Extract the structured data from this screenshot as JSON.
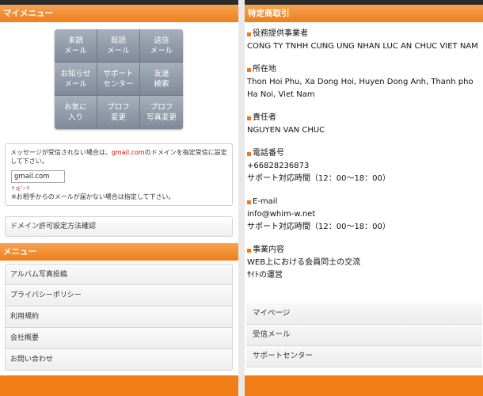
{
  "left_panel": {
    "my_menu_header": "マイメニュー",
    "grid": [
      {
        "line1": "未読",
        "line2": "メール"
      },
      {
        "line1": "既読",
        "line2": "メール"
      },
      {
        "line1": "送信",
        "line2": "メール"
      },
      {
        "line1": "お知らせ",
        "line2": "メール"
      },
      {
        "line1": "サポート",
        "line2": "センター"
      },
      {
        "line1": "友達",
        "line2": "検索"
      },
      {
        "line1": "お気に",
        "line2": "入り"
      },
      {
        "line1": "プロフ",
        "line2": "変更"
      },
      {
        "line1": "プロフ",
        "line2": "写真変更"
      }
    ],
    "notice": {
      "text_before": "メッセージが受信されない場合は、",
      "domain": "gmail.com",
      "text_after": "のドメインを指定受信に設定して下さい。",
      "input_value": "gmail.com",
      "hint_red": "↑ｺﾋﾟｰ↑",
      "hint": "※お相手からのメールが届かない場合は指定して下さい。"
    },
    "domain_settings_button": "ドメイン許可設定方法確認",
    "menu_header": "メニュー",
    "menu_items": [
      "アルバム写真投稿",
      "プライバシーポリシー",
      "利用規約",
      "会社概要",
      "お問い合わせ"
    ]
  },
  "right_panel": {
    "header": "特定商取引",
    "sections": {
      "provider": {
        "title": "役務提供事業者",
        "lines": [
          "CONG TY TNHH CUNG UNG NHAN LUC AN CHUC VIET NAM"
        ]
      },
      "address": {
        "title": "所在地",
        "lines": [
          "Thon Hoi Phu, Xa Dong Hoi, Huyen Dong Anh, Thanh pho Ha Noi, Viet Nam"
        ]
      },
      "manager": {
        "title": "責任者",
        "lines": [
          "NGUYEN VAN CHUC"
        ]
      },
      "phone": {
        "title": "電話番号",
        "lines": [
          "+66828236873",
          "サポート対応時間（12：00～18：00）"
        ]
      },
      "email": {
        "title": "E-mail",
        "lines": [
          "info@whim-w.net",
          "サポート対応時間（12：00～18：00）"
        ]
      },
      "business": {
        "title": "事業内容",
        "lines": [
          "WEB上における会員同士の交流",
          "ｻｲﾄの運営"
        ]
      }
    },
    "bottom_items": [
      "マイページ",
      "受信メール",
      "サポートセンター"
    ]
  },
  "colors": {
    "accent": "#f17e16",
    "grid_top": "#a6afbb",
    "grid_bottom": "#7f8998",
    "red": "#e60000"
  }
}
